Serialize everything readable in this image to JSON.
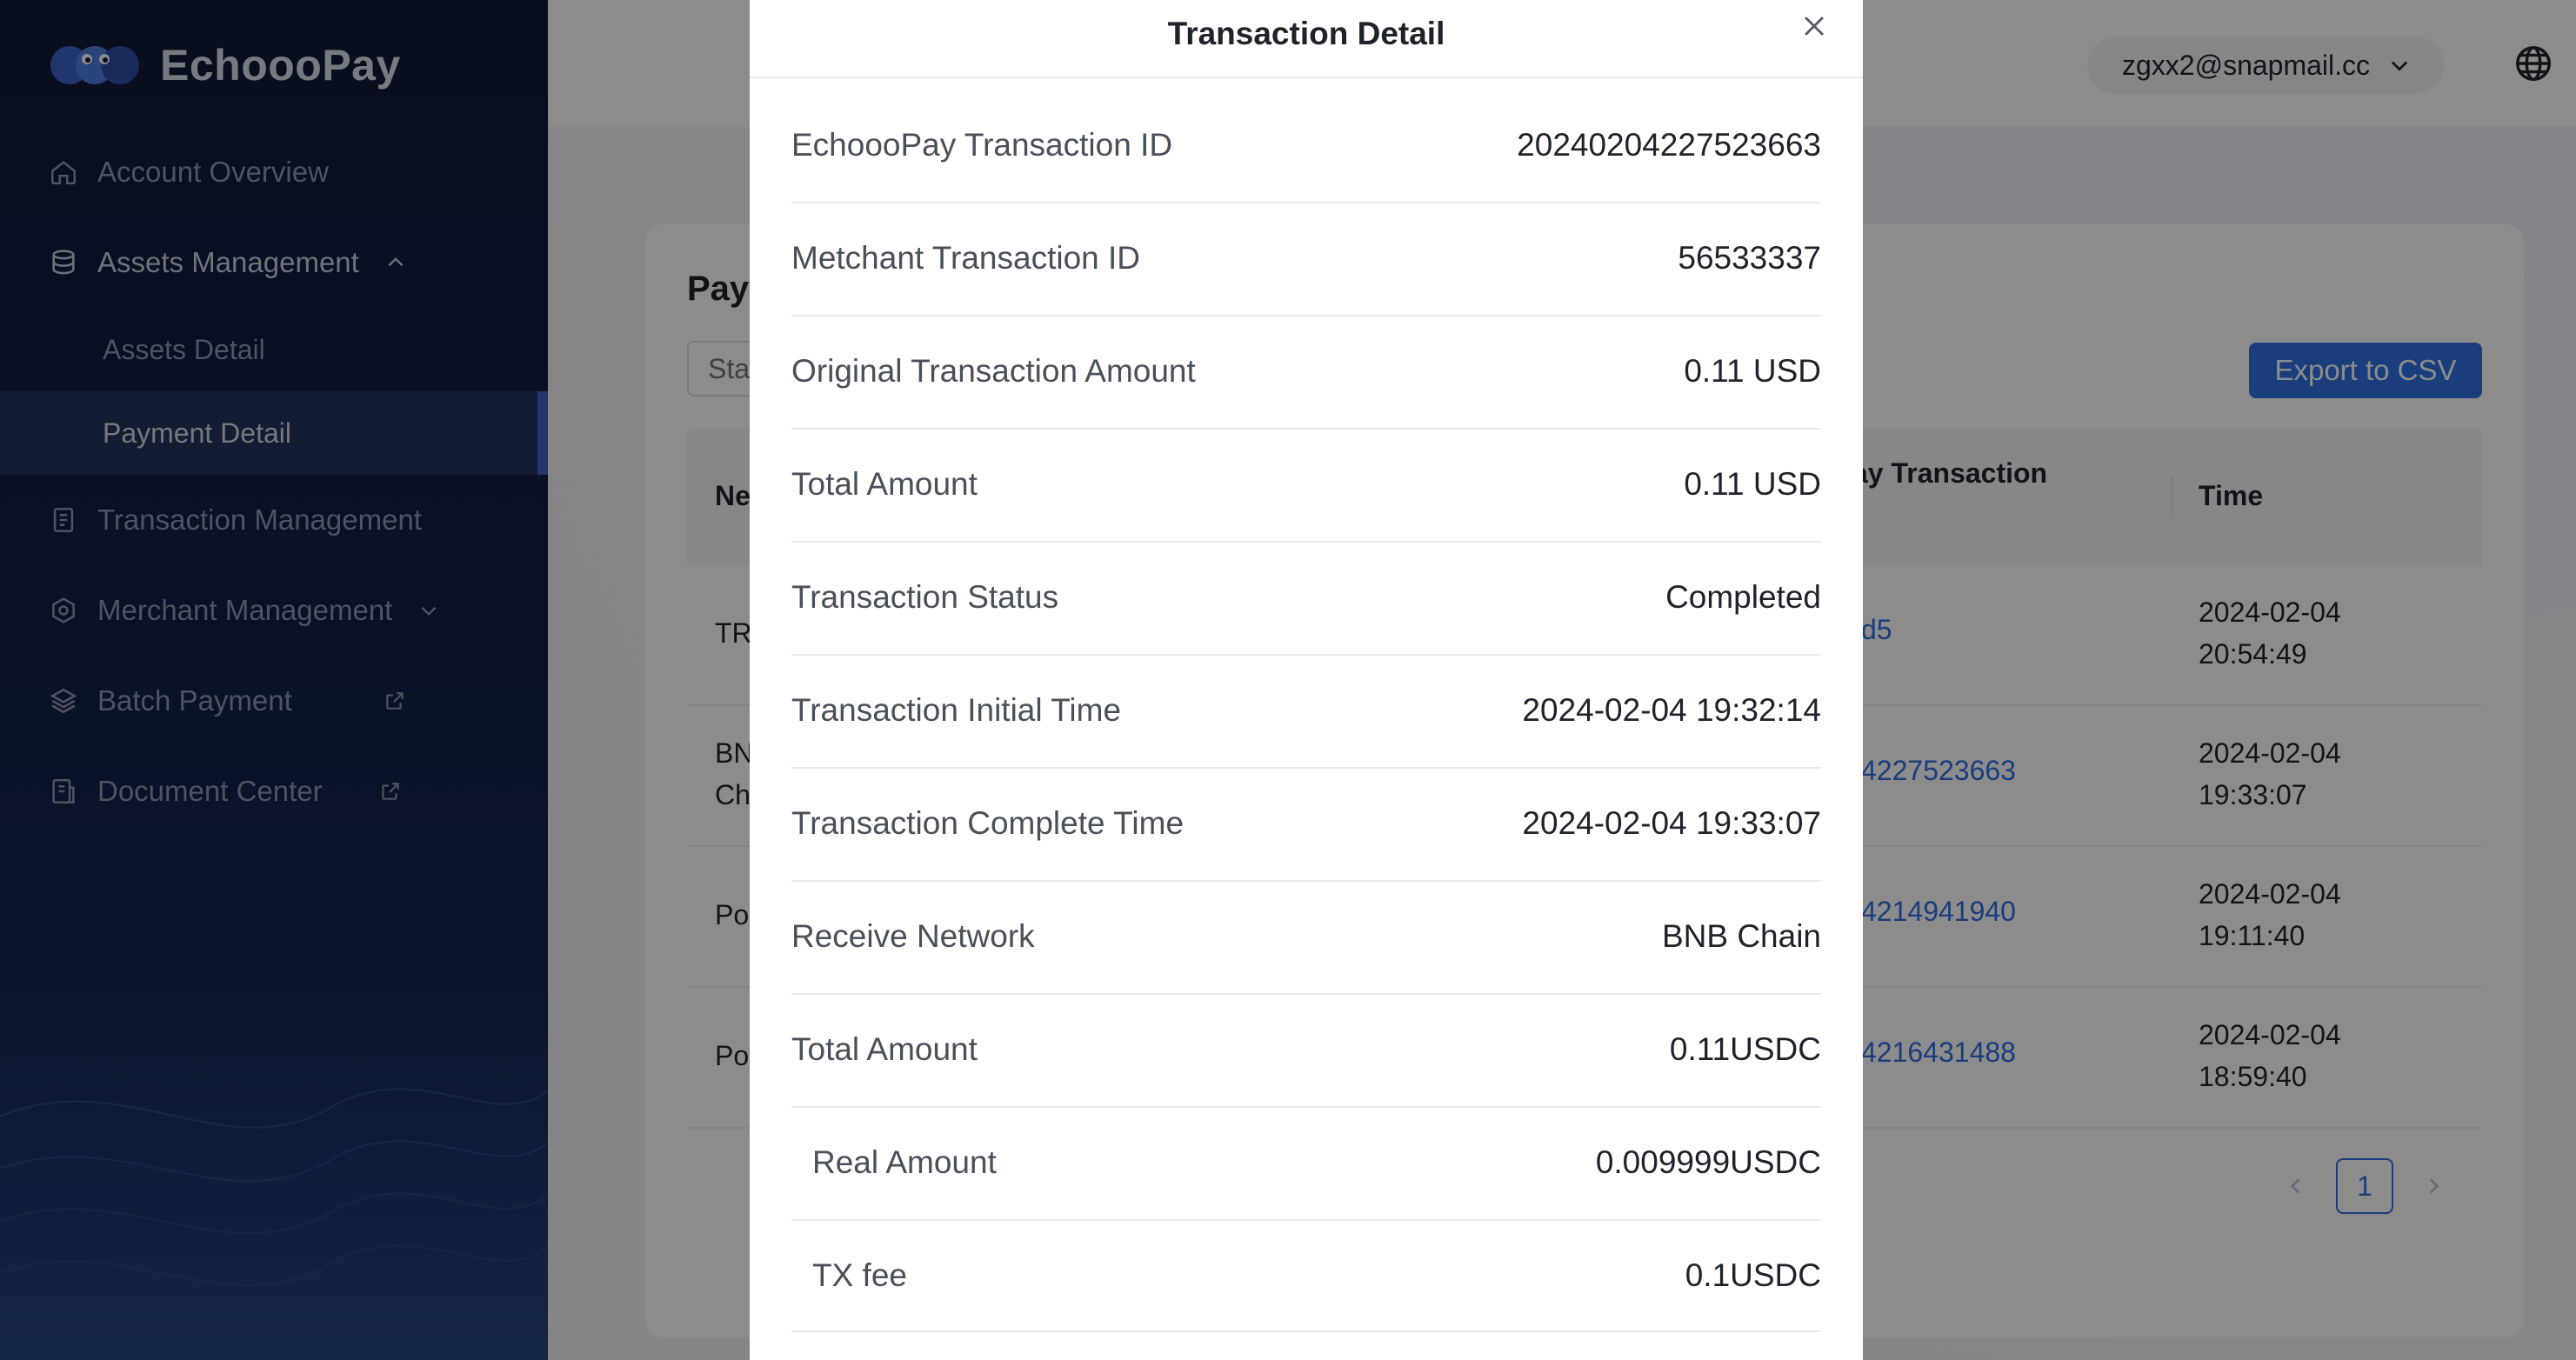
{
  "brand": {
    "name": "EchoooPay"
  },
  "sidebar": {
    "items": [
      {
        "label": "Account Overview",
        "icon": "home-icon"
      },
      {
        "label": "Assets Management",
        "icon": "database-icon",
        "expanded": true,
        "children": [
          {
            "label": "Assets Detail"
          },
          {
            "label": "Payment Detail",
            "active": true
          }
        ]
      },
      {
        "label": "Transaction Management",
        "icon": "document-icon"
      },
      {
        "label": "Merchant Management",
        "icon": "settings-icon"
      },
      {
        "label": "Batch Payment",
        "icon": "layers-icon"
      },
      {
        "label": "Document Center",
        "icon": "file-icon"
      }
    ]
  },
  "header": {
    "user_email": "zgxx2@snapmail.cc",
    "icons": [
      "chevron-down-icon",
      "globe-icon"
    ]
  },
  "page": {
    "title": "Payı",
    "filter_placeholder": "Sta",
    "export_label": "Export to CSV",
    "table": {
      "headers": {
        "col1": "Ne",
        "col2": "ay Transaction",
        "col3": "Time"
      },
      "rows": [
        {
          "col1": "TR",
          "col2": "d5",
          "time": "2024-02-04\n20:54:49"
        },
        {
          "col1": "BN\nCh",
          "col2": "4227523663",
          "time": "2024-02-04\n19:33:07"
        },
        {
          "col1": "Po",
          "col2": "4214941940",
          "time": "2024-02-04\n19:11:40"
        },
        {
          "col1": "Po",
          "col2": "4216431488",
          "time": "2024-02-04\n18:59:40"
        }
      ]
    },
    "pagination": {
      "current": "1"
    }
  },
  "modal": {
    "title": "Transaction Detail",
    "rows": [
      {
        "key": "EchoooPay Transaction ID",
        "value": "20240204227523663"
      },
      {
        "key": "Metchant Transaction ID",
        "value": "56533337"
      },
      {
        "key": "Original Transaction Amount",
        "value": "0.11 USD"
      },
      {
        "key": "Total Amount",
        "value": "0.11 USD"
      },
      {
        "key": "Transaction Status",
        "value": "Completed"
      },
      {
        "key": "Transaction Initial Time",
        "value": "2024-02-04 19:32:14"
      },
      {
        "key": "Transaction Complete Time",
        "value": "2024-02-04 19:33:07"
      },
      {
        "key": "Receive Network",
        "value": "BNB Chain"
      },
      {
        "key": "Total Amount",
        "value": "0.11USDC"
      },
      {
        "key": "Real Amount",
        "value": "0.009999USDC"
      },
      {
        "key": "TX fee",
        "value": "0.1USDC"
      }
    ]
  },
  "colors": {
    "sidebar_bg": "#111a38",
    "accent": "#2f6fe3",
    "active_indicator": "#3d63c9"
  }
}
